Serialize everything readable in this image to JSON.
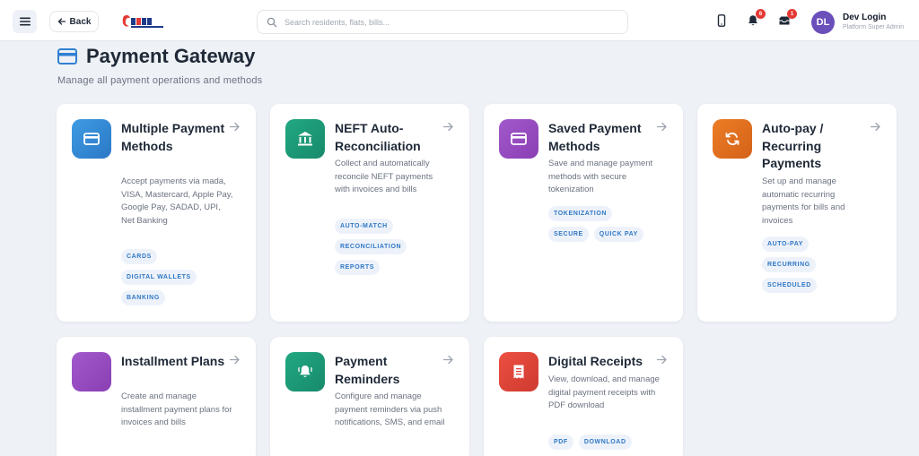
{
  "header": {
    "back_label": "Back",
    "search_placeholder": "Search residents, flats, bills...",
    "notifications_count": "6",
    "messages_count": "1",
    "user": {
      "initials": "DL",
      "name": "Dev Login",
      "role": "Platform Super Admin"
    }
  },
  "page": {
    "title": "Payment Gateway",
    "subtitle": "Manage all payment operations and methods"
  },
  "cards": [
    {
      "title": "Multiple Payment Methods",
      "description": "Accept payments via mada, VISA, Mastercard, Apple Pay, Google Pay, SADAD, UPI, Net Banking",
      "tags": [
        "CARDS",
        "DIGITAL WALLETS",
        "BANKING"
      ],
      "icon": "credit-card-icon",
      "color": "#3b8fd9"
    },
    {
      "title": "NEFT Auto-Reconciliation",
      "description": "Collect and automatically reconcile NEFT payments with invoices and bills",
      "tags": [
        "AUTO-MATCH",
        "RECONCILIATION",
        "REPORTS"
      ],
      "icon": "bank-icon",
      "color": "#1e9a78"
    },
    {
      "title": "Saved Payment Methods",
      "description": "Save and manage payment methods with secure tokenization",
      "tags": [
        "TOKENIZATION",
        "SECURE",
        "QUICK PAY"
      ],
      "icon": "credit-card-icon",
      "color": "#9b4dbf"
    },
    {
      "title": "Auto-pay / Recurring Payments",
      "description": "Set up and manage automatic recurring payments for bills and invoices",
      "tags": [
        "AUTO-PAY",
        "RECURRING",
        "SCHEDULED"
      ],
      "icon": "sync-icon",
      "color": "#e0701f"
    },
    {
      "title": "Installment Plans",
      "description": "Create and manage installment payment plans for invoices and bills",
      "tags": [],
      "icon": "installment-icon",
      "color": "#9b4dbf"
    },
    {
      "title": "Payment Reminders",
      "description": "Configure and manage payment reminders via push notifications, SMS, and email",
      "tags": [],
      "icon": "bell-icon",
      "color": "#1e9a78"
    },
    {
      "title": "Digital Receipts",
      "description": "View, download, and manage digital payment receipts with PDF download",
      "tags": [
        "PDF",
        "DOWNLOAD"
      ],
      "icon": "receipt-icon",
      "color": "#e0453a"
    }
  ]
}
